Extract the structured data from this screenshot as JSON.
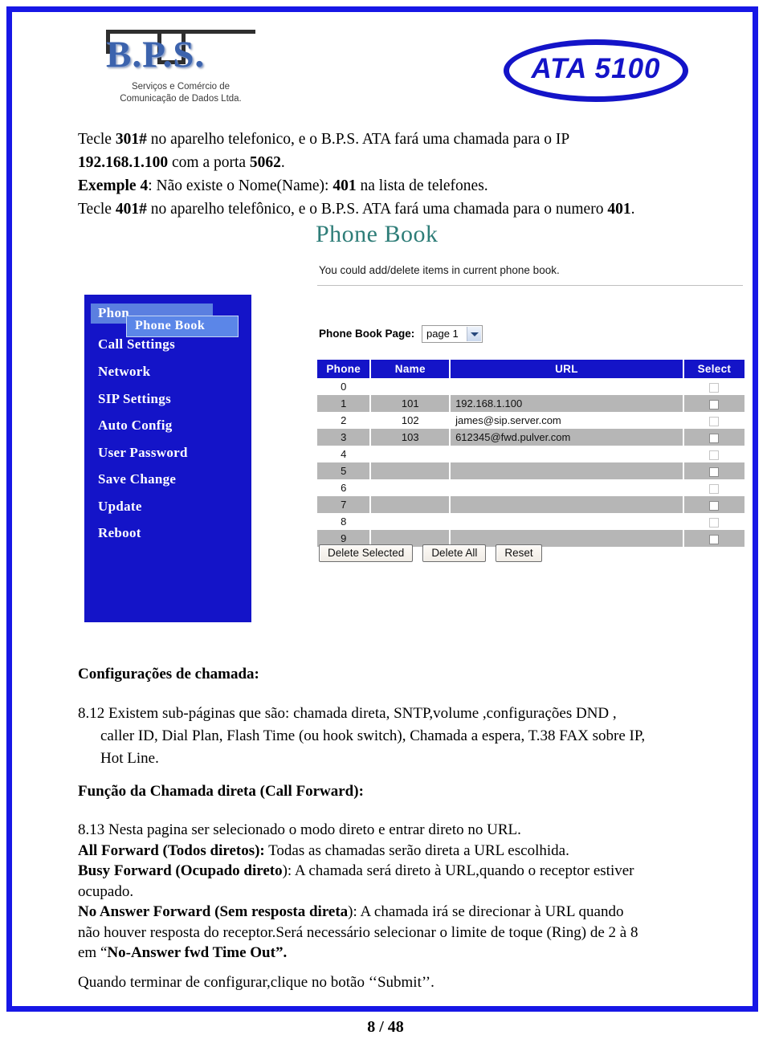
{
  "header": {
    "bps_logo": {
      "letters": "B.P.S.",
      "line1": "Serviços e Comércio de",
      "line2": "Comunicação de Dados Ltda."
    },
    "product_badge": "ATA 5100"
  },
  "intro": {
    "line1_a": "Tecle  ",
    "line1_b": "301#",
    "line1_c": " no aparelho telefonico, e o B.P.S. ATA fará uma chamada para o IP",
    "line2_a": "192.168.1.100",
    "line2_b": " com a porta  ",
    "line2_c": "5062",
    "line2_d": ".",
    "line3_a": "Exemple 4",
    "line3_b": ":  Não existe o Nome(Name): ",
    "line3_c": "401",
    "line3_d": " na lista de telefones.",
    "line4_a": "Tecle ",
    "line4_b": "401#",
    "line4_c": " no aparelho telefônico, e o B.P.S. ATA fará uma chamada para o numero ",
    "line4_d": "401",
    "line4_e": "."
  },
  "screenshot": {
    "title": "Phone Book",
    "description": "You could add/delete items in current phone book.",
    "sidebar": {
      "items": [
        {
          "label": "Phone Book",
          "truncated": "Phon",
          "highlighted": true
        },
        {
          "label": "Call Settings",
          "highlighted": false
        },
        {
          "label": "Network",
          "highlighted": false
        },
        {
          "label": "SIP Settings",
          "highlighted": false
        },
        {
          "label": "Auto Config",
          "highlighted": false
        },
        {
          "label": "User Password",
          "highlighted": false
        },
        {
          "label": "Save Change",
          "highlighted": false
        },
        {
          "label": "Update",
          "highlighted": false
        },
        {
          "label": "Reboot",
          "highlighted": false
        }
      ],
      "tooltip_label": "Phone Book",
      "background_color": "#1414c8",
      "highlight_color": "#5b86e8"
    },
    "page_selector": {
      "label": "Phone Book Page:",
      "value": "page 1",
      "options": [
        "page 1"
      ]
    },
    "table": {
      "headers": [
        "Phone",
        "Name",
        "URL",
        "Select"
      ],
      "header_color": "#1414c8",
      "rows": [
        {
          "phone": "0",
          "name": "",
          "url": "",
          "checked": false
        },
        {
          "phone": "1",
          "name": "101",
          "url": "192.168.1.100",
          "checked": false
        },
        {
          "phone": "2",
          "name": "102",
          "url": "james@sip.server.com",
          "checked": false
        },
        {
          "phone": "3",
          "name": "103",
          "url": "612345@fwd.pulver.com",
          "checked": false
        },
        {
          "phone": "4",
          "name": "",
          "url": "",
          "checked": false
        },
        {
          "phone": "5",
          "name": "",
          "url": "",
          "checked": false
        },
        {
          "phone": "6",
          "name": "",
          "url": "",
          "checked": false
        },
        {
          "phone": "7",
          "name": "",
          "url": "",
          "checked": false
        },
        {
          "phone": "8",
          "name": "",
          "url": "",
          "checked": false
        },
        {
          "phone": "9",
          "name": "",
          "url": "",
          "checked": false
        }
      ]
    },
    "buttons": {
      "delete_selected": "Delete Selected",
      "delete_all": "Delete All",
      "reset": "Reset"
    }
  },
  "body": {
    "section_title": "Configurações de chamada:",
    "para_812_line1": "8.12 Existem sub-páginas que são: chamada direta, SNTP,volume ,configurações DND ,",
    "para_812_line2": "caller ID, Dial Plan, Flash Time (ou hook switch), Chamada a espera, T.38 FAX sobre IP,",
    "para_812_line3": "Hot Line.",
    "sub_title_a": "Função da Chamada direta",
    "sub_title_b": " (Call Forward):",
    "para_813_line1": "8.13 Nesta pagina ser selecionado o modo direto e entrar direto no URL.",
    "all_forward_label": "All Forward (Todos diretos):",
    "all_forward_text": " Todas as chamadas serão direta a URL escolhida.",
    "busy_forward_label_a": "Busy Forward (",
    "busy_forward_label_b": "Ocupado direto",
    "busy_forward_label_c": ")",
    "busy_forward_text": ": A chamada será direto à URL,quando o receptor estiver",
    "busy_forward_text2": "ocupado.",
    "no_answer_label_a": "No Answer Forward (",
    "no_answer_label_b": "Sem resposta direta",
    "no_answer_label_c": ")",
    "no_answer_text1": ": A chamada irá se direcionar à URL quando",
    "no_answer_text2": "não houver resposta do receptor.Será necessário selecionar o limite de toque (Ring) de 2 à 8",
    "no_answer_text3_a": "em “",
    "no_answer_text3_b": "No-Answer fwd Time Out”.",
    "closing": "Quando terminar de configurar,clique no botão ‘‘Submit’’."
  },
  "footer": {
    "page_number": "8 / 48"
  },
  "colors": {
    "frame_blue": "#1717e6",
    "ui_blue": "#1414c8",
    "teal_heading": "#2e7d78",
    "row_gray": "#b6b6b6"
  }
}
